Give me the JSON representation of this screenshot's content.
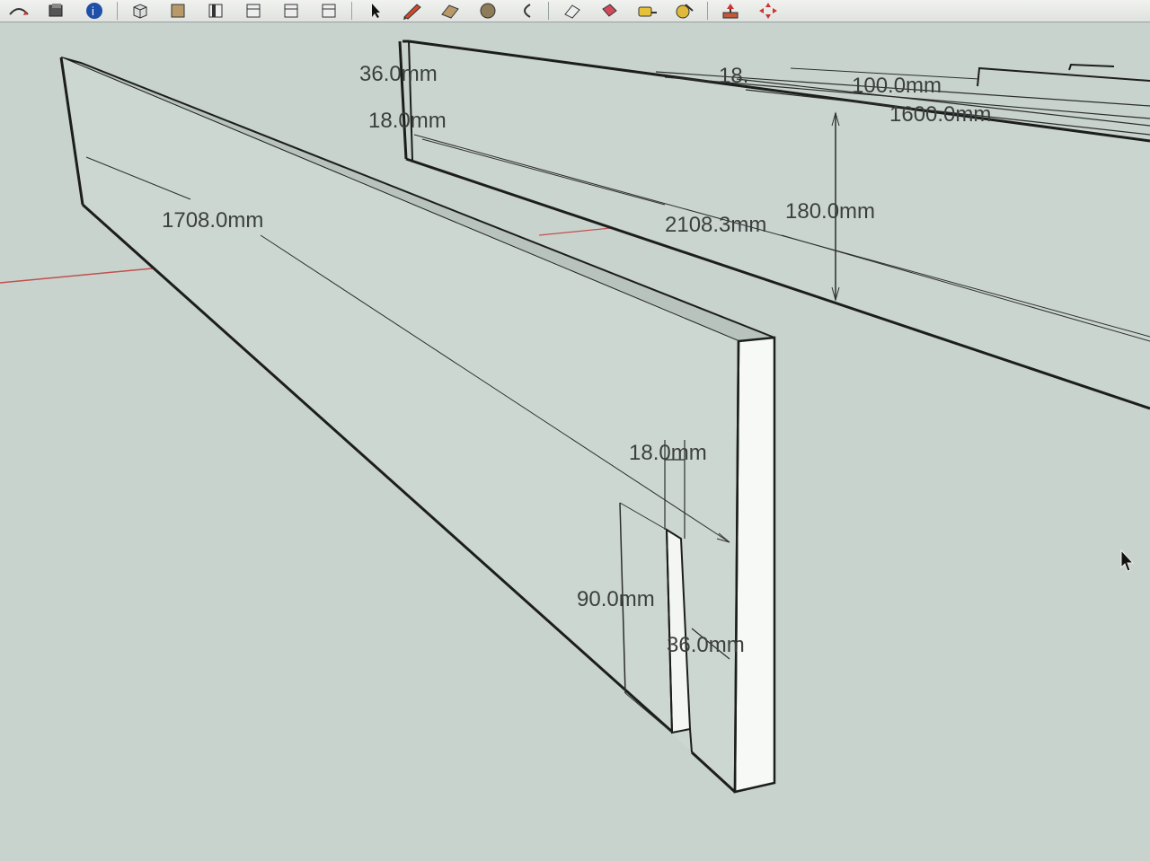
{
  "toolbar": {
    "tools": [
      {
        "name": "orbit-tool",
        "icon": "orbit-icon"
      },
      {
        "name": "component-tool",
        "icon": "component-icon"
      },
      {
        "name": "model-info-tool",
        "icon": "info-icon"
      },
      {
        "name": "iso-view",
        "icon": "iso-view-icon"
      },
      {
        "name": "top-view",
        "icon": "top-view-icon"
      },
      {
        "name": "front-view",
        "icon": "front-view-icon"
      },
      {
        "name": "right-view",
        "icon": "right-view-icon"
      },
      {
        "name": "back-view",
        "icon": "back-view-icon"
      },
      {
        "name": "left-view",
        "icon": "left-view-icon"
      },
      {
        "name": "select-tool",
        "icon": "select-arrow-icon"
      },
      {
        "name": "pencil-tool",
        "icon": "pencil-icon"
      },
      {
        "name": "rectangle-tool",
        "icon": "rectangle-icon"
      },
      {
        "name": "circle-tool",
        "icon": "circle-icon"
      },
      {
        "name": "arc-tool",
        "icon": "arc-icon"
      },
      {
        "name": "eraser-tool",
        "icon": "eraser-icon"
      },
      {
        "name": "paint-bucket-tool",
        "icon": "paint-bucket-icon"
      },
      {
        "name": "tape-measure-tool",
        "icon": "tape-measure-icon"
      },
      {
        "name": "dimension-tool",
        "icon": "dimension-icon"
      },
      {
        "name": "push-pull-tool",
        "icon": "push-pull-icon"
      },
      {
        "name": "move-tool",
        "icon": "move-icon"
      }
    ]
  },
  "dimensions": {
    "board_length": "1708.0mm",
    "back_length": "2108.3mm",
    "back_height": "180.0mm",
    "top_width": "36.0mm",
    "top_thickness": "18.0mm",
    "far_short": "18.",
    "far_mid": "100.0mm",
    "far_long": "1600.0mm",
    "notch_width": "18.0mm",
    "notch_height": "90.0mm",
    "notch_depth": "36.0mm"
  },
  "colors": {
    "background": "#c9d3ce",
    "edge": "#1c1e1d",
    "dim_line": "#2b2e2d",
    "face_light": "#f7f9f6",
    "face_top": "#b9c3be",
    "axis_red": "#c0504d"
  }
}
